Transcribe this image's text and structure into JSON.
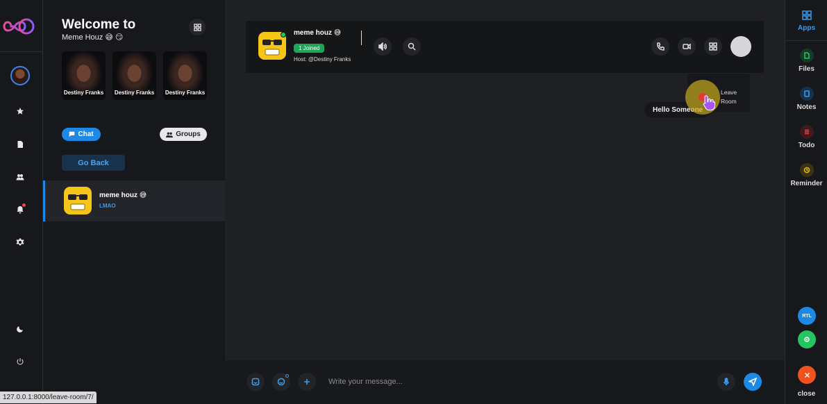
{
  "sidebar_left": {
    "logo": "infinity-logo",
    "nav": [
      "star-icon",
      "document-icon",
      "users-icon",
      "bell-icon",
      "settings-icon"
    ],
    "bottom": [
      "moon-icon",
      "power-icon"
    ],
    "notification_dot_color": "#ef4444"
  },
  "panel": {
    "welcome_title": "Welcome to",
    "subtitle": "Meme Houz 😅 😏",
    "stories": [
      {
        "name": "Destiny Franks"
      },
      {
        "name": "Destiny Franks"
      },
      {
        "name": "Destiny Franks"
      }
    ],
    "chat_label": "Chat",
    "groups_label": "Groups",
    "go_back_label": "Go Back",
    "chat_items": [
      {
        "name": "meme houz 😅",
        "last_message": "LMAO"
      }
    ]
  },
  "header": {
    "room_name": "meme houz 😅",
    "joined_badge": "1 Joined",
    "host": "Host: @Destiny Franks"
  },
  "dropdown": {
    "leave_room_line1": "Leave",
    "leave_room_line2": "Room"
  },
  "messages": [
    {
      "text": "Hello Someone"
    }
  ],
  "composer": {
    "placeholder": "Write your message..."
  },
  "sidebar_right": {
    "apps_label": "Apps",
    "items": [
      {
        "label": "Files",
        "color": "#22c55e"
      },
      {
        "label": "Notes",
        "color": "#3b9cf0"
      },
      {
        "label": "Todo",
        "color": "#ef4444"
      },
      {
        "label": "Reminder",
        "color": "#eab308"
      }
    ],
    "rtl_label": "RTL",
    "close_label": "close"
  },
  "status_url": "127.0.0.1:8000/leave-room/7/"
}
